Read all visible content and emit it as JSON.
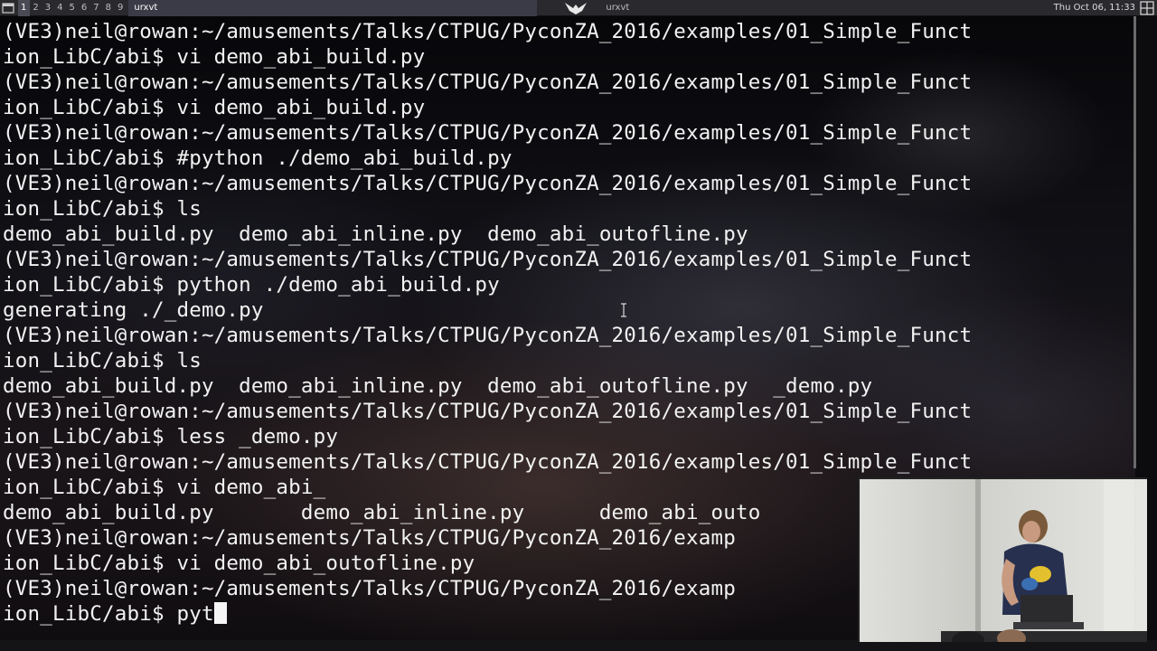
{
  "panel": {
    "workspaces": [
      "1",
      "2",
      "3",
      "4",
      "5",
      "6",
      "7",
      "8",
      "9"
    ],
    "active_workspace": "1",
    "tasks": [
      {
        "label": "urxvt",
        "active": true
      },
      {
        "label": "urxvt",
        "active": false
      }
    ],
    "clock": "Thu Oct 06, 11:33",
    "icons": [
      "window-menu-icon",
      "wm-logo-icon",
      "layout-grid-icon"
    ]
  },
  "terminal": {
    "lines": [
      "(VE3)neil@rowan:~/amusements/Talks/CTPUG/PyconZA_2016/examples/01_Simple_Funct",
      "ion_LibC/abi$ vi demo_abi_build.py",
      "(VE3)neil@rowan:~/amusements/Talks/CTPUG/PyconZA_2016/examples/01_Simple_Funct",
      "ion_LibC/abi$ vi demo_abi_build.py",
      "(VE3)neil@rowan:~/amusements/Talks/CTPUG/PyconZA_2016/examples/01_Simple_Funct",
      "ion_LibC/abi$ #python ./demo_abi_build.py",
      "(VE3)neil@rowan:~/amusements/Talks/CTPUG/PyconZA_2016/examples/01_Simple_Funct",
      "ion_LibC/abi$ ls",
      "demo_abi_build.py  demo_abi_inline.py  demo_abi_outofline.py",
      "(VE3)neil@rowan:~/amusements/Talks/CTPUG/PyconZA_2016/examples/01_Simple_Funct",
      "ion_LibC/abi$ python ./demo_abi_build.py",
      "generating ./_demo.py",
      "(VE3)neil@rowan:~/amusements/Talks/CTPUG/PyconZA_2016/examples/01_Simple_Funct",
      "ion_LibC/abi$ ls",
      "demo_abi_build.py  demo_abi_inline.py  demo_abi_outofline.py  _demo.py",
      "(VE3)neil@rowan:~/amusements/Talks/CTPUG/PyconZA_2016/examples/01_Simple_Funct",
      "ion_LibC/abi$ less _demo.py",
      "(VE3)neil@rowan:~/amusements/Talks/CTPUG/PyconZA_2016/examples/01_Simple_Funct",
      "ion_LibC/abi$ vi demo_abi_",
      "demo_abi_build.py       demo_abi_inline.py      demo_abi_outo",
      "(VE3)neil@rowan:~/amusements/Talks/CTPUG/PyconZA_2016/examp",
      "ion_LibC/abi$ vi demo_abi_outofline.py",
      "(VE3)neil@rowan:~/amusements/Talks/CTPUG/PyconZA_2016/examp",
      "ion_LibC/abi$ pyt"
    ]
  },
  "colors": {
    "text": "#f2f2f2",
    "panel_bg": "#2a2a2e",
    "active_workspace_bg": "#4a4a55"
  }
}
